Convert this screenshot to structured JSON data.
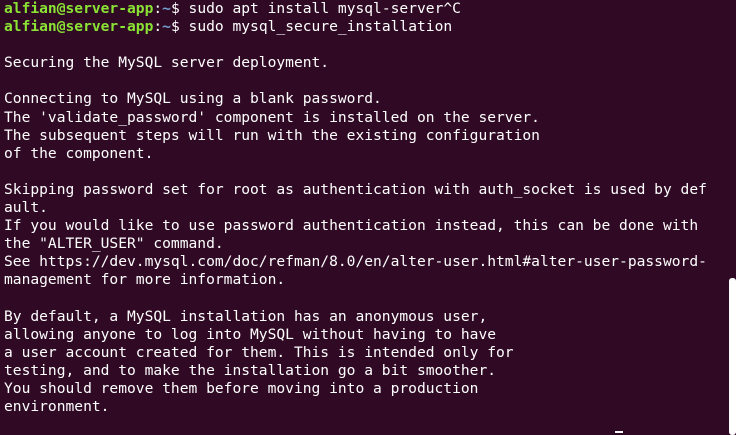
{
  "prompt": {
    "user_host": "alfian@server-app",
    "path": "~",
    "symbol": "$"
  },
  "commands": [
    " sudo apt install mysql-server^C",
    " sudo mysql_secure_installation"
  ],
  "output": [
    "",
    "Securing the MySQL server deployment.",
    "",
    "Connecting to MySQL using a blank password.",
    "The 'validate_password' component is installed on the server.",
    "The subsequent steps will run with the existing configuration",
    "of the component.",
    "",
    "Skipping password set for root as authentication with auth_socket is used by def",
    "ault.",
    "If you would like to use password authentication instead, this can be done with",
    "the \"ALTER_USER\" command.",
    "See https://dev.mysql.com/doc/refman/8.0/en/alter-user.html#alter-user-password-",
    "management for more information.",
    "",
    "By default, a MySQL installation has an anonymous user,",
    "allowing anyone to log into MySQL without having to have",
    "a user account created for them. This is intended only for",
    "testing, and to make the installation go a bit smoother.",
    "You should remove them before moving into a production",
    "environment."
  ],
  "colors": {
    "background": "#300a24",
    "text": "#ffffff",
    "user_host": "#8ae234",
    "path": "#729fcf"
  }
}
